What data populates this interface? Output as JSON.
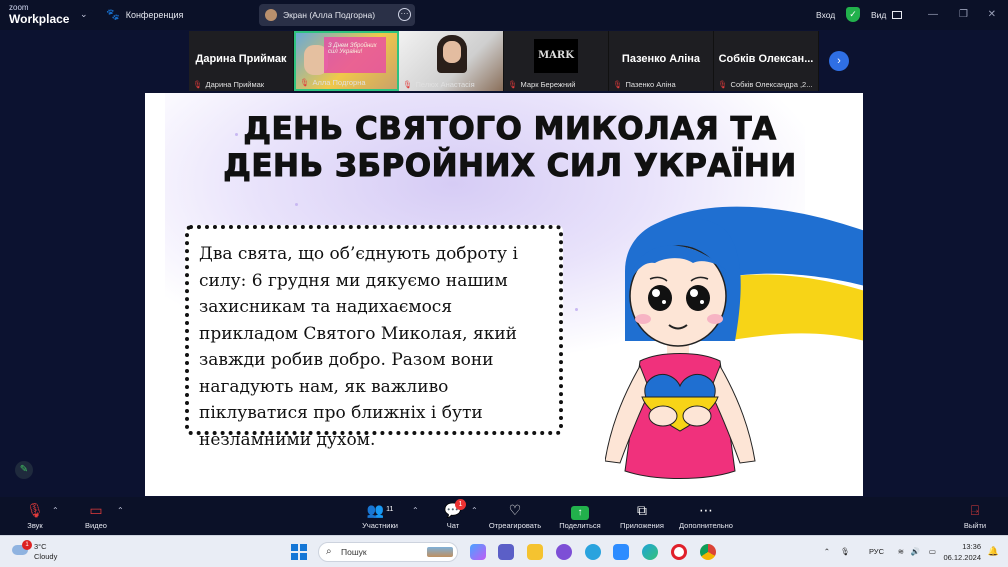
{
  "titlebar": {
    "brand_top": "zoom",
    "brand_bottom": "Workplace",
    "conference_label": "Конференция",
    "screen_share_label": "Экран (Алла Подгорна)",
    "login_label": "Вход",
    "view_label": "Вид"
  },
  "participants": [
    {
      "big": "Дарина Приймак",
      "name": "Дарина Приймак",
      "type": "name"
    },
    {
      "big": "",
      "name": "Алла Подгорна",
      "type": "video1",
      "active": true
    },
    {
      "big": "",
      "name": "Пелюх Анастасія",
      "type": "video2"
    },
    {
      "big": "MARK",
      "name": "Марк Бережний",
      "type": "mark"
    },
    {
      "big": "Пазенко Аліна",
      "name": "Пазенко Аліна",
      "type": "name"
    },
    {
      "big": "Собків Олексан...",
      "name": "Собків Олександра ,2...",
      "type": "name"
    }
  ],
  "slide": {
    "title_line1": "ДЕНЬ СВЯТОГО МИКОЛАЯ ТА",
    "title_line2": "ДЕНЬ ЗБРОЙНИХ СИЛ УКРАЇНИ",
    "body": "Два свята, що об’єднують доброту і силу: 6 грудня ми дякуємо нашим захисникам та надихаємося прикладом Святого Миколая, який завжди робив добро. Разом вони нагадують нам, як важливо піклуватися про ближніх і бути незламними духом.",
    "mini_slide_text": "З Днем Збройних сил України!"
  },
  "toolbar": {
    "sound": "Звук",
    "video": "Видео",
    "participants": "Участники",
    "participants_count": "11",
    "chat": "Чат",
    "chat_badge": "1",
    "react": "Отреагировать",
    "share": "Поделиться",
    "apps": "Приложения",
    "more": "Дополнительно",
    "leave": "Выйти"
  },
  "taskbar": {
    "temp": "3°C",
    "weather": "Cloudy",
    "weather_badge": "1",
    "search_placeholder": "Пошук",
    "lang": "РУС",
    "time": "13:36",
    "date": "06.12.2024"
  },
  "colors": {
    "zoom_bg": "#0b1128",
    "accent_green": "#22b14c",
    "accent_blue": "#2f6fe4",
    "slide_glow": "#d6ccf5",
    "ukraine_blue": "#1f6fd1",
    "ukraine_yellow": "#f7d417",
    "dress_pink": "#f0317c"
  }
}
